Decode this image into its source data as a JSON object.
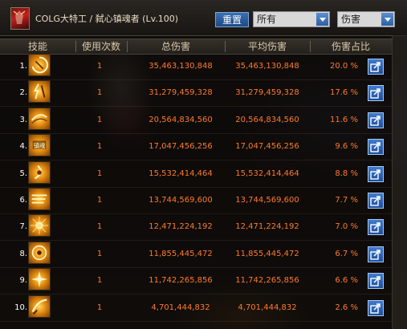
{
  "window": {
    "char_name": "COLG大特工 / 弑心镇魂者 (Lv.100)",
    "reset_label": "重置",
    "filter_value": "所有",
    "sort_value": "伤害"
  },
  "columns": {
    "skill": "技能",
    "uses": "使用次数",
    "total": "总伤害",
    "avg": "平均伤害",
    "share": "伤害占比"
  },
  "rows": [
    {
      "rank": "1.",
      "icon": "swirl-fire-skill-icon",
      "uses": "1",
      "total": "35,463,130,848",
      "avg": "35,463,130,848",
      "pct": "20.0",
      "unit": "%"
    },
    {
      "rank": "2.",
      "icon": "figure-strike-skill-icon",
      "uses": "1",
      "total": "31,279,459,328",
      "avg": "31,279,459,328",
      "pct": "17.6",
      "unit": "%"
    },
    {
      "rank": "3.",
      "icon": "wave-slash-skill-icon",
      "uses": "1",
      "total": "20,564,834,560",
      "avg": "20,564,834,560",
      "pct": "11.6",
      "unit": "%"
    },
    {
      "rank": "4.",
      "icon": "zhenhun-text-skill-icon",
      "uses": "1",
      "total": "17,047,456,256",
      "avg": "17,047,456,256",
      "pct": "9.6",
      "unit": "%"
    },
    {
      "rank": "5.",
      "icon": "crescent-slash-skill-icon",
      "uses": "1",
      "total": "15,532,414,464",
      "avg": "15,532,414,464",
      "pct": "8.8",
      "unit": "%"
    },
    {
      "rank": "6.",
      "icon": "blade-rush-skill-icon",
      "uses": "1",
      "total": "13,744,569,600",
      "avg": "13,744,569,600",
      "pct": "7.7",
      "unit": "%"
    },
    {
      "rank": "7.",
      "icon": "light-burst-skill-icon",
      "uses": "1",
      "total": "12,471,224,192",
      "avg": "12,471,224,192",
      "pct": "7.0",
      "unit": "%"
    },
    {
      "rank": "8.",
      "icon": "rune-circle-skill-icon",
      "uses": "1",
      "total": "11,855,445,472",
      "avg": "11,855,445,472",
      "pct": "6.7",
      "unit": "%"
    },
    {
      "rank": "9.",
      "icon": "star-burst-skill-icon",
      "uses": "1",
      "total": "11,742,265,856",
      "avg": "11,742,265,856",
      "pct": "6.6",
      "unit": "%"
    },
    {
      "rank": "10.",
      "icon": "sword-swing-skill-icon",
      "uses": "1",
      "total": "4,701,444,832",
      "avg": "4,701,444,832",
      "pct": "2.6",
      "unit": "%"
    }
  ],
  "colors": {
    "value_text": "#ff7a2a",
    "header_text": "#d8c8a8",
    "accent_blue": "#2c5fa6"
  }
}
